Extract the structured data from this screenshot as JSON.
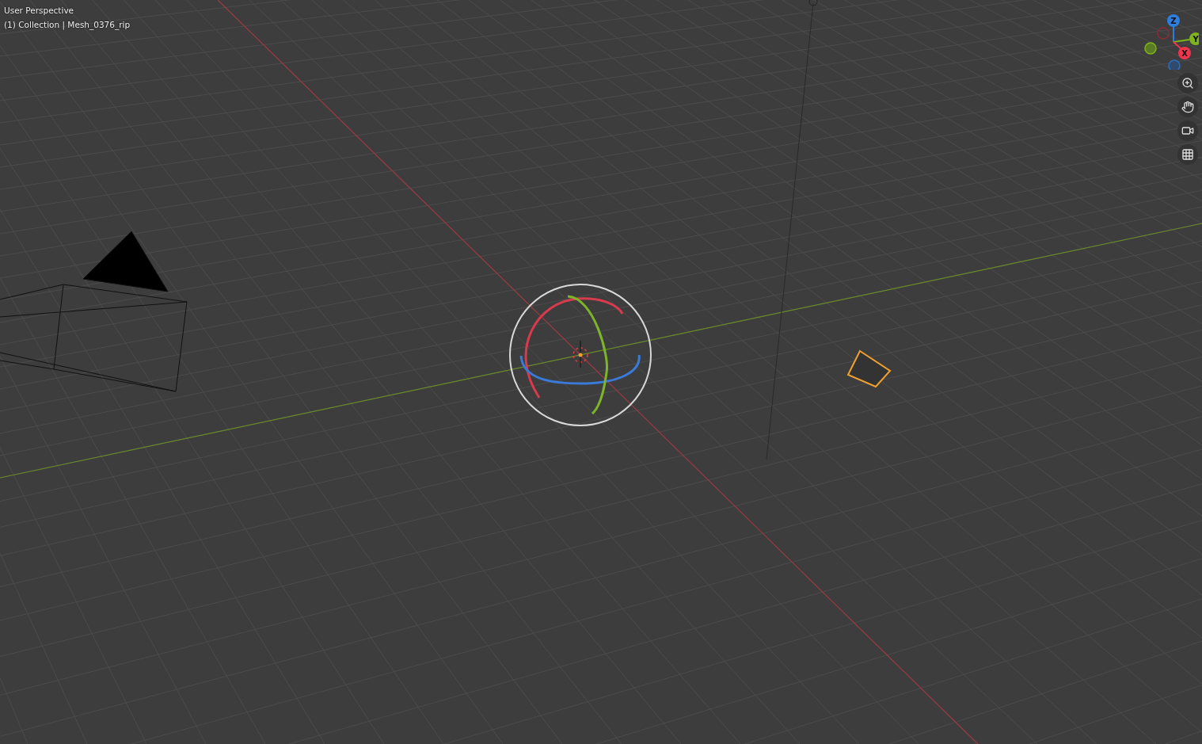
{
  "viewport": {
    "title": "User Perspective",
    "subtitle": "(1) Collection | Mesh_0376_rip"
  },
  "axis_gizmo": [
    {
      "label": "Z",
      "color": "#2e7ee0"
    },
    {
      "label": "Y",
      "color": "#7fb41c"
    },
    {
      "label": "X",
      "color": "#f0354f"
    }
  ]
}
